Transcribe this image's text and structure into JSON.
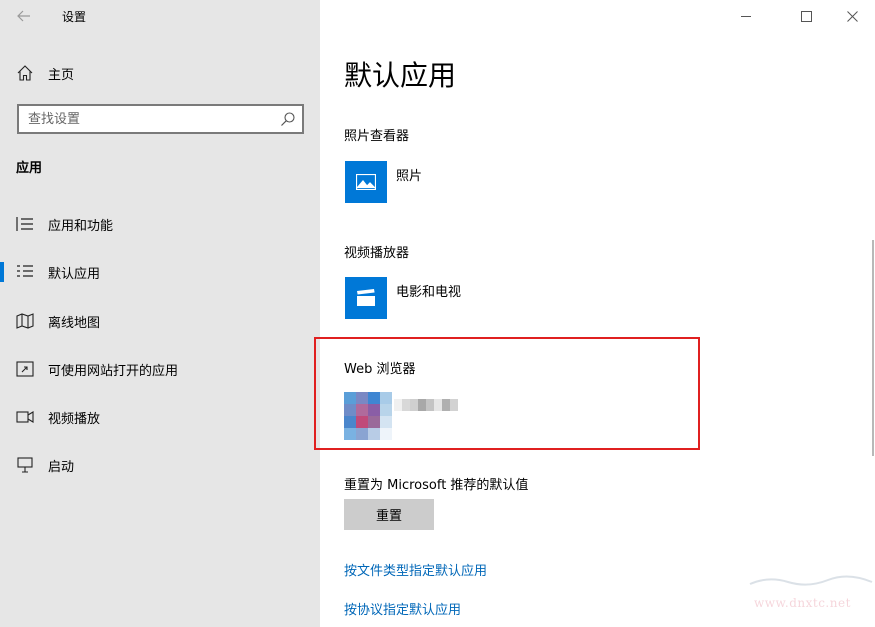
{
  "window": {
    "app_title": "设置",
    "back_icon": "back-arrow-icon",
    "minimize_icon": "minimize-icon",
    "maximize_icon": "maximize-icon",
    "close_icon": "close-icon"
  },
  "sidebar": {
    "home_label": "主页",
    "home_icon": "home-icon",
    "search": {
      "placeholder": "查找设置",
      "icon": "search-icon"
    },
    "section_header": "应用",
    "items": [
      {
        "label": "应用和功能",
        "icon": "apps-list-icon",
        "selected": false
      },
      {
        "label": "默认应用",
        "icon": "default-apps-icon",
        "selected": true
      },
      {
        "label": "离线地图",
        "icon": "offline-map-icon",
        "selected": false
      },
      {
        "label": "可使用网站打开的应用",
        "icon": "web-open-icon",
        "selected": false
      },
      {
        "label": "视频播放",
        "icon": "video-playback-icon",
        "selected": false
      },
      {
        "label": "启动",
        "icon": "startup-icon",
        "selected": false
      }
    ],
    "accent_color": "#0078d7"
  },
  "main": {
    "title": "默认应用",
    "groups": [
      {
        "label": "照片查看器",
        "app_name": "照片",
        "app_icon": "photos-icon"
      },
      {
        "label": "视频播放器",
        "app_name": "电影和电视",
        "app_icon": "movies-tv-icon"
      },
      {
        "label": "Web 浏览器",
        "app_name": "",
        "app_icon": "browser-icon-pixelated"
      }
    ],
    "reset_label": "重置为 Microsoft 推荐的默认值",
    "reset_button": "重置",
    "links": [
      "按文件类型指定默认应用",
      "按协议指定默认应用"
    ],
    "highlight_color": "#e02020",
    "link_color": "#0067b8"
  },
  "watermark": {
    "text_url": "www.dnxtc.net"
  }
}
